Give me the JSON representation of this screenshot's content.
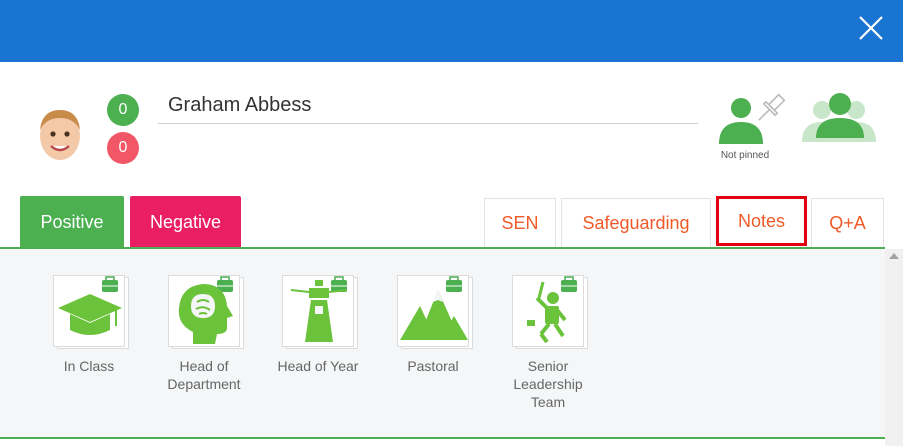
{
  "colors": {
    "header": "#1a75d2",
    "positive": "#4caf50",
    "negative": "#e91e63",
    "accent_text": "#f05a28",
    "highlight": "#e3000f"
  },
  "student": {
    "name": "Graham Abbess",
    "positive_points": "0",
    "negative_points": "0"
  },
  "pin": {
    "status_label": "Not pinned"
  },
  "tabs": {
    "positive": "Positive",
    "negative": "Negative",
    "sen": "SEN",
    "safeguarding": "Safeguarding",
    "notes": "Notes",
    "qa": "Q+A"
  },
  "behaviours": [
    {
      "label": "In Class",
      "icon": "graduation-cap-icon"
    },
    {
      "label": "Head of Department",
      "icon": "head-brain-icon"
    },
    {
      "label": "Head of Year",
      "icon": "lighthouse-icon"
    },
    {
      "label": "Pastoral",
      "icon": "mountains-icon"
    },
    {
      "label": "Senior Leadership Team",
      "icon": "climber-icon"
    }
  ]
}
